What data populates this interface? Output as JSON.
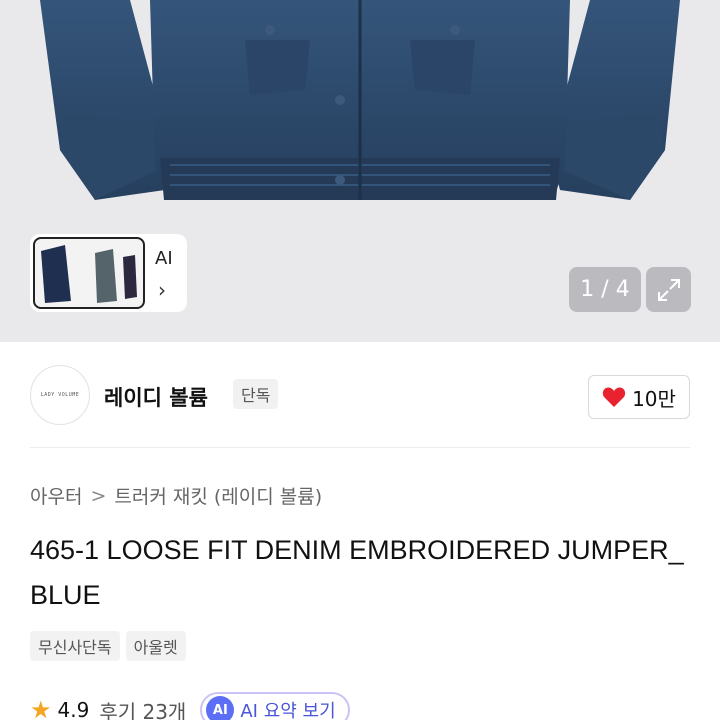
{
  "gallery": {
    "ai_label": "AI",
    "page_indicator": "1 / 4",
    "chevron_glyph": "›",
    "current_page": 1,
    "total_pages": 4
  },
  "brand": {
    "logo_text": "LADY VOLUME",
    "name": "레이디 볼륨",
    "badge": "단독"
  },
  "like": {
    "count": "10만",
    "icon": "heart-icon",
    "color": "#e8232f"
  },
  "breadcrumb": {
    "category": "아우터",
    "separator": ">",
    "subcategory": "트러커 재킷 (레이디 볼륨)"
  },
  "product": {
    "title": "465-1 LOOSE FIT DENIM EMBROIDERED JUMPER_BLUE",
    "tags": [
      "무신사단독",
      "아울렛"
    ]
  },
  "rating": {
    "star_glyph": "★",
    "score": "4.9",
    "reviews": "후기 23개",
    "ai_chip": "AI",
    "ai_summary": "AI 요약 보기"
  },
  "colors": {
    "star": "#f5a623",
    "ai_accent": "#5b6ef5",
    "denim": "#2f4f73"
  }
}
